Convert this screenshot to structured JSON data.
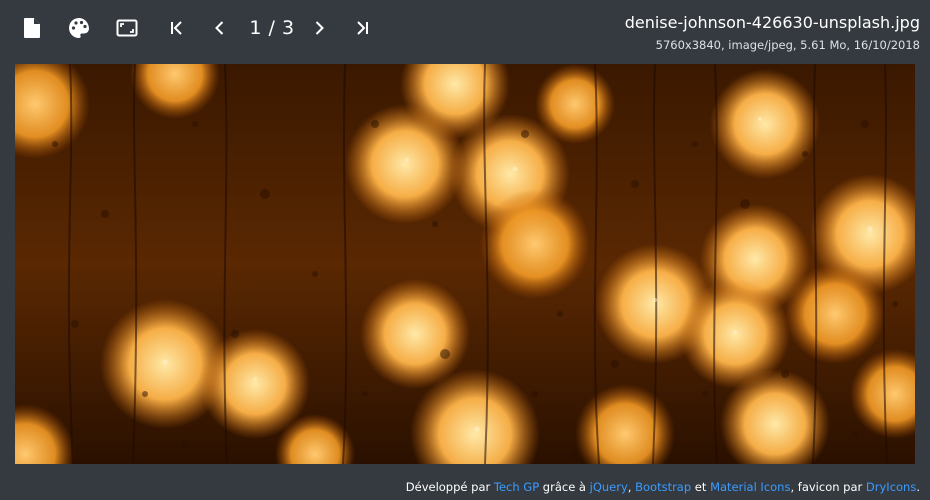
{
  "toolbar": {
    "buttons": [
      {
        "icon": "file-icon",
        "label": "file"
      },
      {
        "icon": "palette-icon",
        "label": "theme"
      },
      {
        "icon": "fit-screen-icon",
        "label": "fit"
      },
      {
        "icon": "first-page-icon",
        "label": "first"
      },
      {
        "icon": "chevron-left-icon",
        "label": "previous"
      },
      {
        "icon": "chevron-right-icon",
        "label": "next"
      },
      {
        "icon": "last-page-icon",
        "label": "last"
      }
    ],
    "pager": "1 / 3"
  },
  "file": {
    "name": "denise-johnson-426630-unsplash.jpg",
    "meta": "5760x3840, image/jpeg, 5.61 Mo, 16/10/2018"
  },
  "image": {
    "description_icon": "photo-rain-bokeh",
    "palette": {
      "dark": "#2a1200",
      "mid": "#8a3f00",
      "glow": "#ffb54a",
      "bright": "#ffe9a8"
    }
  },
  "footer": {
    "prefix": "Développé par ",
    "author": "Tech GP",
    "thanks": " grâce à ",
    "lib1": "jQuery",
    "sep1": ", ",
    "lib2": "Bootstrap",
    "and": " et ",
    "lib3": "Material Icons",
    "favicon_prefix": ", favicon par ",
    "lib4": "DryIcons",
    "suffix": "."
  },
  "colors": {
    "background": "#343a40",
    "link": "#3b9cff",
    "text": "#ffffff"
  }
}
